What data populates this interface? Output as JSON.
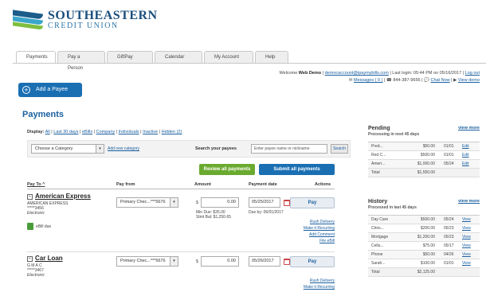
{
  "brand": {
    "name": "SOUTHEASTERN",
    "sub": "CREDIT UNION"
  },
  "tabs": [
    "Payments",
    "Pay a Person",
    "GiftPay",
    "Calendar",
    "My Account",
    "Help"
  ],
  "welcome": {
    "prefix": "Welcome",
    "user": "Web Demo",
    "email": "democaccount@ipaymybills.com",
    "last_login": "Last login: 05:44 PM on 05/16/2017",
    "logout": "Log out",
    "messages": "Messages ( 0 )",
    "phone": "844-387-9656",
    "chat": "Chat Now",
    "view_demo": "View demo"
  },
  "add_payee": "Add a Payee",
  "page_title": "Payments",
  "display": {
    "label": "Display:",
    "options": [
      "All",
      "Last 30 days",
      "eBills",
      "Company",
      "Individuals",
      "Inactive",
      "Hidden (2)"
    ]
  },
  "filter": {
    "category": "Choose a Category",
    "add_category": "Add new category",
    "search_label": "Search your payees",
    "search_placeholder": "Enter payee name or nickname",
    "search_button": "Search"
  },
  "buttons": {
    "review": "Review all payments",
    "submit": "Submit all payments"
  },
  "columns": {
    "pay_to": "Pay To",
    "pay_from": "Pay from",
    "amount": "Amount",
    "payment_date": "Payment date",
    "actions": "Actions"
  },
  "payees": [
    {
      "name": "American Express",
      "line1": "AMERICAN EXPRESS",
      "line2": "*****3456",
      "line3": "Electronic",
      "ebill": "eBill due",
      "account": "Primary Chec...***5676",
      "amount": "0.00",
      "min_due": "Min Due: $35.00",
      "stmt_bal": "Stmt Bal: $1,250.65",
      "date": "05/25/2017",
      "due_by": "Due by: 06/01/2017",
      "pay": "Pay",
      "actions": [
        "Rush Delivery",
        "Make it Recurring",
        "Add Comment",
        "File eBill"
      ]
    },
    {
      "name": "Car Loan",
      "line1": "G M A C",
      "line2": "*****3467",
      "line3": "Electronic",
      "account": "Primary Chec...***5676",
      "amount": "0.00",
      "date": "05/26/2017",
      "pay": "Pay",
      "actions": [
        "Rush Delivery",
        "Make it Recurring"
      ]
    }
  ],
  "pending": {
    "title": "Pending",
    "subtitle": "Processing in next 45 days",
    "view_more": "view more",
    "rows": [
      {
        "name": "Pred...",
        "amount": "$50.00",
        "date": "01/01",
        "action": "Edit"
      },
      {
        "name": "Red C...",
        "amount": "$500.00",
        "date": "01/01",
        "action": "Edit"
      },
      {
        "name": "Ameri...",
        "amount": "$1,000.00",
        "date": "05/24",
        "action": "Edit"
      }
    ],
    "total_label": "Total",
    "total": "$1,550.00"
  },
  "history": {
    "title": "History",
    "subtitle": "Processed in last 45 days",
    "view_more": "view more",
    "rows": [
      {
        "name": "Day Care",
        "amount": "$500.00",
        "date": "05/24",
        "action": "View"
      },
      {
        "name": "Chris...",
        "amount": "$200.00",
        "date": "05/23",
        "action": "View"
      },
      {
        "name": "Mortgage",
        "amount": "$1,200.00",
        "date": "05/23",
        "action": "View"
      },
      {
        "name": "Cellu...",
        "amount": "$75.00",
        "date": "05/17",
        "action": "View"
      },
      {
        "name": "Phone",
        "amount": "$50.00",
        "date": "04/26",
        "action": "View"
      },
      {
        "name": "Sarah...",
        "amount": "$100.00",
        "date": "01/01",
        "action": "View"
      }
    ],
    "total_label": "Total",
    "total": "$2,125.00"
  }
}
